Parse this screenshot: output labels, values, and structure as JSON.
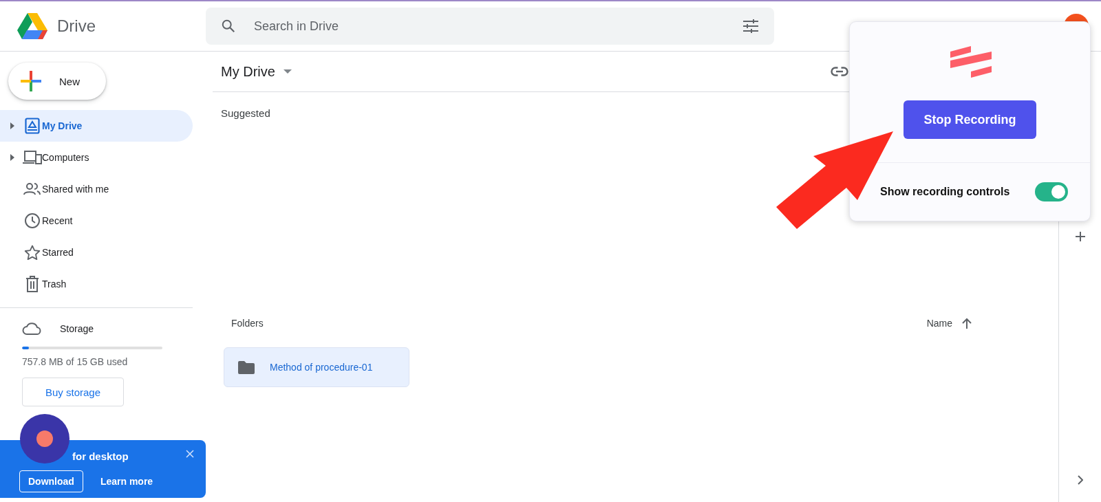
{
  "header": {
    "product": "Drive",
    "search": {
      "placeholder": "Search in Drive"
    }
  },
  "new_button": "New",
  "sidebar": {
    "items": [
      {
        "label": "My Drive",
        "selected": true,
        "expandable": true
      },
      {
        "label": "Computers",
        "selected": false,
        "expandable": true
      },
      {
        "label": "Shared with me",
        "selected": false,
        "expandable": false
      },
      {
        "label": "Recent",
        "selected": false,
        "expandable": false
      },
      {
        "label": "Starred",
        "selected": false,
        "expandable": false
      },
      {
        "label": "Trash",
        "selected": false,
        "expandable": false
      }
    ]
  },
  "storage": {
    "label": "Storage",
    "level": 0.05,
    "usage": "757.8 MB of 15 GB used",
    "button": "Buy storage"
  },
  "banner": {
    "title": "for desktop",
    "buttons": [
      "Download",
      "Learn more"
    ]
  },
  "main": {
    "title": "My Drive",
    "suggested": "Suggested",
    "folders_label": "Folders",
    "sort": "Name",
    "folders": [
      {
        "name": "Method of procedure-01",
        "selected": true
      }
    ]
  },
  "recorder": {
    "button": "Stop Recording",
    "toggle": {
      "label": "Show recording controls",
      "on": true
    }
  }
}
